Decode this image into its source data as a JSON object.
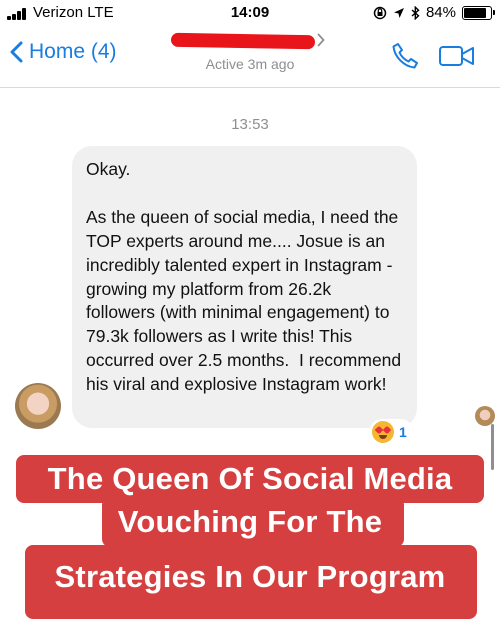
{
  "status_bar": {
    "carrier": "Verizon  LTE",
    "time": "14:09",
    "battery_percent": "84%",
    "battery_level": 0.84
  },
  "nav": {
    "back_label": "Home (4)",
    "active_status": "Active 3m ago"
  },
  "conversation": {
    "timestamp": "13:53",
    "message": "Okay.\n\nAs the queen of social media, I need the TOP experts around me.... Josue is an incredibly talented expert in Instagram - growing my platform from 26.2k followers (with minimal engagement) to 79.3k followers as I write this! This occurred over 2.5 months.  I recommend his viral and explosive Instagram work!",
    "reaction_count": "1"
  },
  "caption": {
    "line1": "The Queen Of Social Media",
    "line2": "Vouching For The",
    "line3": "Strategies In Our Program"
  },
  "colors": {
    "accent": "#1a7de0",
    "caption_bg": "#d63f3f",
    "bubble_bg": "#f0f0f0",
    "redaction": "#e8151b"
  }
}
